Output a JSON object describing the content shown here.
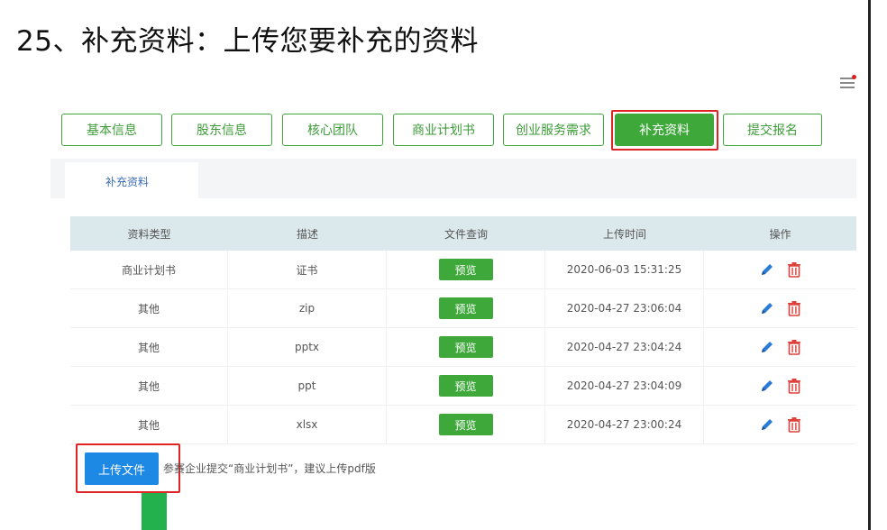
{
  "heading": "25、补充资料：上传您要补充的资料",
  "tabs": [
    {
      "label": "基本信息"
    },
    {
      "label": "股东信息"
    },
    {
      "label": "核心团队"
    },
    {
      "label": "商业计划书"
    },
    {
      "label": "创业服务需求"
    },
    {
      "label": "补充资料",
      "active": true
    },
    {
      "label": "提交报名"
    }
  ],
  "subtab": "补充资料",
  "table": {
    "headers": [
      "资料类型",
      "描述",
      "文件查询",
      "上传时间",
      "操作"
    ],
    "preview_label": "预览",
    "rows": [
      {
        "type": "商业计划书",
        "desc": "证书",
        "time": "2020-06-03 15:31:25"
      },
      {
        "type": "其他",
        "desc": "zip",
        "time": "2020-04-27 23:06:04"
      },
      {
        "type": "其他",
        "desc": "pptx",
        "time": "2020-04-27 23:04:24"
      },
      {
        "type": "其他",
        "desc": "ppt",
        "time": "2020-04-27 23:04:09"
      },
      {
        "type": "其他",
        "desc": "xlsx",
        "time": "2020-04-27 23:00:24"
      }
    ]
  },
  "upload_button": "上传文件",
  "hint": "参赛企业提交“商业计划书”，建议上传pdf版",
  "colors": {
    "accent_green": "#3ea83a",
    "highlight_red": "#e02424",
    "upload_blue": "#1e88e5",
    "header_bg": "#dce9ec",
    "edit_blue": "#2a7bd6",
    "delete_red": "#e0403a"
  },
  "icons": {
    "menu": "menu-icon",
    "edit": "pencil-icon",
    "delete": "trash-icon"
  }
}
